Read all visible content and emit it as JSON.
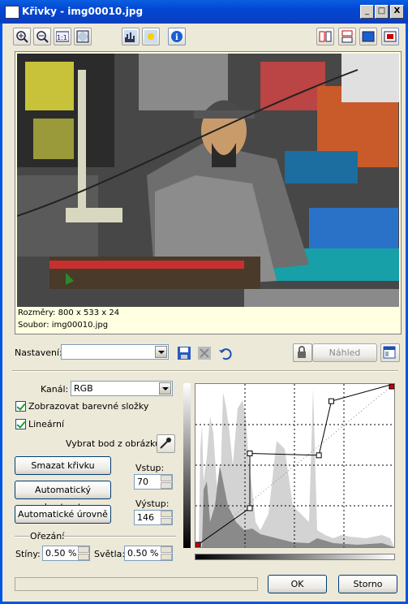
{
  "window": {
    "title": "Křivky - img00010.jpg"
  },
  "titlebar_buttons": {
    "minimize": "_",
    "maximize": "□",
    "close": "X"
  },
  "toolbar": {
    "left_tools": [
      "zoom-in-icon",
      "zoom-out-icon",
      "actual-size-icon",
      "fit-window-icon"
    ],
    "mid_tools": [
      "histogram-icon",
      "brightness-icon",
      "info-icon"
    ],
    "right_tools": [
      "split-vertical-icon",
      "split-horizontal-icon",
      "original-view-icon",
      "result-view-icon"
    ]
  },
  "preview": {
    "dimensions": "Rozměry: 800 x 533 x 24",
    "file": "Soubor: img00010.jpg"
  },
  "settings": {
    "label": "Nastavení:",
    "value": "",
    "preview_button": "Náhled"
  },
  "channel": {
    "label": "Kanál:",
    "value": "RGB"
  },
  "options": {
    "show_color_components": "Zobrazovat barevné složky",
    "linear": "Lineární",
    "pick_point": "Vybrat bod z obrázku:"
  },
  "buttons": {
    "clear_curve": "Smazat křivku",
    "auto_contrast": "Automatický kontrast",
    "auto_levels": "Automatické úrovně",
    "ok": "OK",
    "cancel": "Storno"
  },
  "input": {
    "label": "Vstup:",
    "value": "70"
  },
  "output": {
    "label": "Výstup:",
    "value": "146"
  },
  "clipping": {
    "label": "Ořezání",
    "shadows_label": "Stíny:",
    "shadows_value": "0.50 %",
    "highlights_label": "Světla:",
    "highlights_value": "0.50 %"
  },
  "curve": {
    "points": [
      [
        0,
        0
      ],
      [
        70,
        60
      ],
      [
        70,
        146
      ],
      [
        159,
        143
      ],
      [
        175,
        228
      ],
      [
        255,
        255
      ]
    ],
    "selected_input": 70,
    "selected_output": 146,
    "range": [
      0,
      255
    ]
  }
}
